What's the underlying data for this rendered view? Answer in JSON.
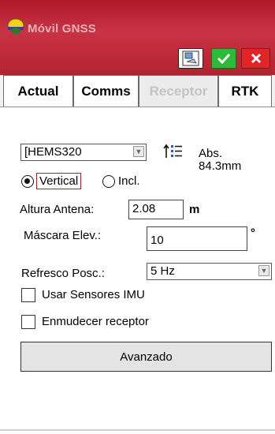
{
  "title_bar": {
    "app_title": "Móvil GNSS",
    "logo_icon": "helmet-icon",
    "buttons": [
      {
        "name": "receiver-config-button",
        "icon": "receiver-icon"
      },
      {
        "name": "ok-button",
        "icon": "check-icon",
        "color": "#2bbb39"
      },
      {
        "name": "cancel-button",
        "icon": "x-icon",
        "color": "#e22327"
      }
    ]
  },
  "tabs": {
    "items": [
      {
        "label": "Actual"
      },
      {
        "label": "Comms"
      },
      {
        "label": "Receptor",
        "selected": true
      },
      {
        "label": "RTK"
      }
    ]
  },
  "receptor": {
    "antenna_select": "[HEMS320",
    "abs_label": "Abs.",
    "abs_value": "84.3mm",
    "measure_mode": {
      "vertical_label": "Vertical",
      "incl_label": "Incl.",
      "selected": "Vertical"
    },
    "antenna_height_label": "Altura Antena:",
    "antenna_height_value": "2.08",
    "antenna_height_unit": "m",
    "elev_mask_label": "Máscara Elev.:",
    "elev_mask_value": "10",
    "elev_mask_unit": "°",
    "refresh_label": "Refresco Posc.:",
    "refresh_value": "5 Hz",
    "imu_label": "Usar Sensores IMU",
    "imu_checked": false,
    "mute_label": "Enmudecer receptor",
    "mute_checked": false,
    "advanced_button": "Avanzado"
  },
  "colors": {
    "title_bar": "#c02c3c",
    "ok": "#2bbb39",
    "cancel": "#e22327",
    "inactive_tab_text": "#c4c4c4"
  }
}
